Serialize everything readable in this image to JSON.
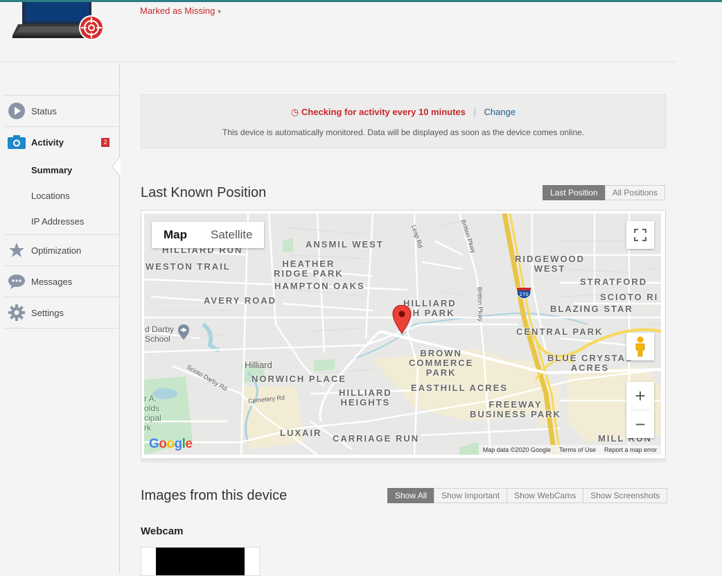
{
  "header": {
    "status_label": "Marked as Missing",
    "status_caret": "▾"
  },
  "sidebar": {
    "items": [
      {
        "label": "Status",
        "icon": "play-circle-icon"
      },
      {
        "label": "Activity",
        "icon": "camera-icon",
        "badge": "2"
      },
      {
        "label": "Optimization",
        "icon": "star-icon"
      },
      {
        "label": "Messages",
        "icon": "chat-bubble-icon"
      },
      {
        "label": "Settings",
        "icon": "gear-icon"
      }
    ],
    "sub_items": [
      "Summary",
      "Locations",
      "IP Addresses"
    ]
  },
  "info": {
    "checking": "Checking for activity every 10 minutes",
    "separator": "|",
    "change": "Change",
    "message": "This device is automatically monitored. Data will be displayed as soon as the device comes online."
  },
  "position": {
    "title": "Last Known Position",
    "buttons": [
      "Last Position",
      "All Positions"
    ],
    "active": "Last Position"
  },
  "map": {
    "types": [
      "Map",
      "Satellite"
    ],
    "active_type": "Map",
    "zoom_in": "+",
    "zoom_out": "−",
    "attribution": [
      "Map data ©2020 Google",
      "Terms of Use",
      "Report a map error"
    ],
    "logo": "Google",
    "interstate": "270",
    "labels": {
      "hilliard_run": "HILLIARD RUN",
      "ansmil_west": "ANSMIL WEST",
      "weston_trail": "WESTON TRAIL",
      "heather_ridge": "HEATHER\nRIDGE PARK",
      "hampton_oaks": "HAMPTON OAKS",
      "avery_road": "AVERY ROAD",
      "hilliard_park": "HILLIARD\nCH PARK",
      "ridgewood_west": "RIDGEWOOD\nWEST",
      "stratford": "STRATFORD",
      "scioto": "SCIOTO RI",
      "blazing_star": "BLAZING STAR",
      "central_park": "CENTRAL PARK",
      "brown_commerce": "BROWN\nCOMMERCE\nPARK",
      "blue_crystal": "BLUE CRYSTAL\nACRES",
      "hilliard": "Hilliard",
      "norwich_place": "NORWICH PLACE",
      "hilliard_heights": "HILLIARD\nHEIGHTS",
      "easthill_acres": "EASTHILL ACRES",
      "freeway_park": "FREEWAY\nBUSINESS PARK",
      "luxair": "LUXAIR",
      "carriage_run": "CARRIAGE RUN",
      "mill_run": "MILL RUN",
      "darby_school": "d Darby\nSchool",
      "reynolds": "r A.\nolds\ncipal\nrk"
    },
    "roads": {
      "leap_rd": "Leap Rd",
      "britton_pkwy_1": "Britton Pkwy",
      "britton_pkwy_2": "Britton Pkwy",
      "scioto_darby": "Scioto Darby Rd",
      "cemetery_rd": "Cemetery Rd"
    }
  },
  "images": {
    "title": "Images from this device",
    "buttons": [
      "Show All",
      "Show Important",
      "Show WebCams",
      "Show Screenshots"
    ],
    "active": "Show All",
    "webcam_title": "Webcam"
  },
  "colors": {
    "accent_red": "#c62828",
    "link_blue": "#1a5e8a",
    "active_segment": "#7b7b7b",
    "top_bar": "#2e7d85"
  }
}
